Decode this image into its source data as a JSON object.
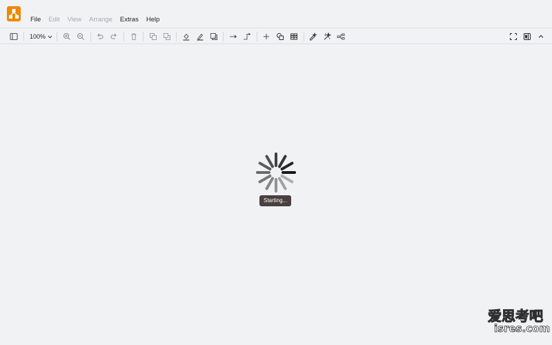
{
  "app": {
    "logo_icon": "drawio-logo-icon",
    "brand_color": "#f08705"
  },
  "menubar": {
    "items": [
      {
        "label": "File",
        "enabled": true
      },
      {
        "label": "Edit",
        "enabled": false
      },
      {
        "label": "View",
        "enabled": false
      },
      {
        "label": "Arrange",
        "enabled": false
      },
      {
        "label": "Extras",
        "enabled": true
      },
      {
        "label": "Help",
        "enabled": true
      }
    ]
  },
  "toolbar": {
    "zoom": {
      "value": "100%",
      "icon": "chevron-down-icon"
    },
    "buttons": [
      "format-panel-toggle-icon",
      "zoom-in-icon",
      "zoom-out-icon",
      "undo-icon",
      "redo-icon",
      "delete-icon",
      "to-front-icon",
      "to-back-icon",
      "fill-color-icon",
      "line-color-icon",
      "shadow-icon",
      "connection-arrow-icon",
      "waypoint-icon",
      "insert-plus-icon",
      "shapes-icon",
      "table-icon",
      "edit-style-icon",
      "magic-icon",
      "layout-icon",
      "fullscreen-icon",
      "sidebar-toggle-icon",
      "collapse-chevron-icon"
    ]
  },
  "loader": {
    "status_text": "Starting...",
    "spinner_icon": "loading-spinner-icon"
  },
  "watermark": {
    "line1": "爱思考吧",
    "line2": "isres.com"
  }
}
